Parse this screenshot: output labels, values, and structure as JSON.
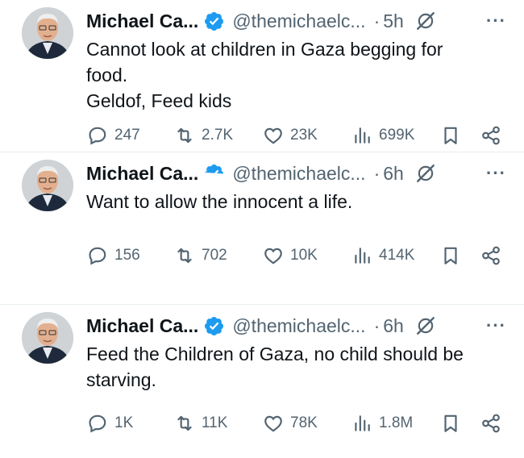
{
  "tweets": [
    {
      "name": "Michael Ca...",
      "handle": "@themichaelc...",
      "separator": "·",
      "time": "5h",
      "lines": [
        "Cannot look at children in Gaza begging for",
        "food.",
        "Geldof, Feed kids"
      ],
      "replies": "247",
      "reposts": "2.7K",
      "likes": "23K",
      "views": "699K"
    },
    {
      "name": "Michael Ca...",
      "handle": "@themichaelc...",
      "separator": "·",
      "time": "6h",
      "lines": [
        "Want to allow the innocent a life."
      ],
      "replies": "156",
      "reposts": "702",
      "likes": "10K",
      "views": "414K"
    },
    {
      "name": "Michael Ca...",
      "handle": "@themichaelc...",
      "separator": "·",
      "time": "6h",
      "lines": [
        "Feed the Children of Gaza, no child should be",
        "starving."
      ],
      "replies": "1K",
      "reposts": "11K",
      "likes": "78K",
      "views": "1.8M"
    }
  ],
  "more_glyph": "···",
  "colors": {
    "verified": "#1d9bf0",
    "muted": "#536471",
    "text": "#0f1419"
  },
  "icons": [
    "verified-badge-icon",
    "grok-icon",
    "more-icon",
    "reply-icon",
    "repost-icon",
    "like-icon",
    "views-icon",
    "bookmark-icon",
    "share-icon"
  ]
}
